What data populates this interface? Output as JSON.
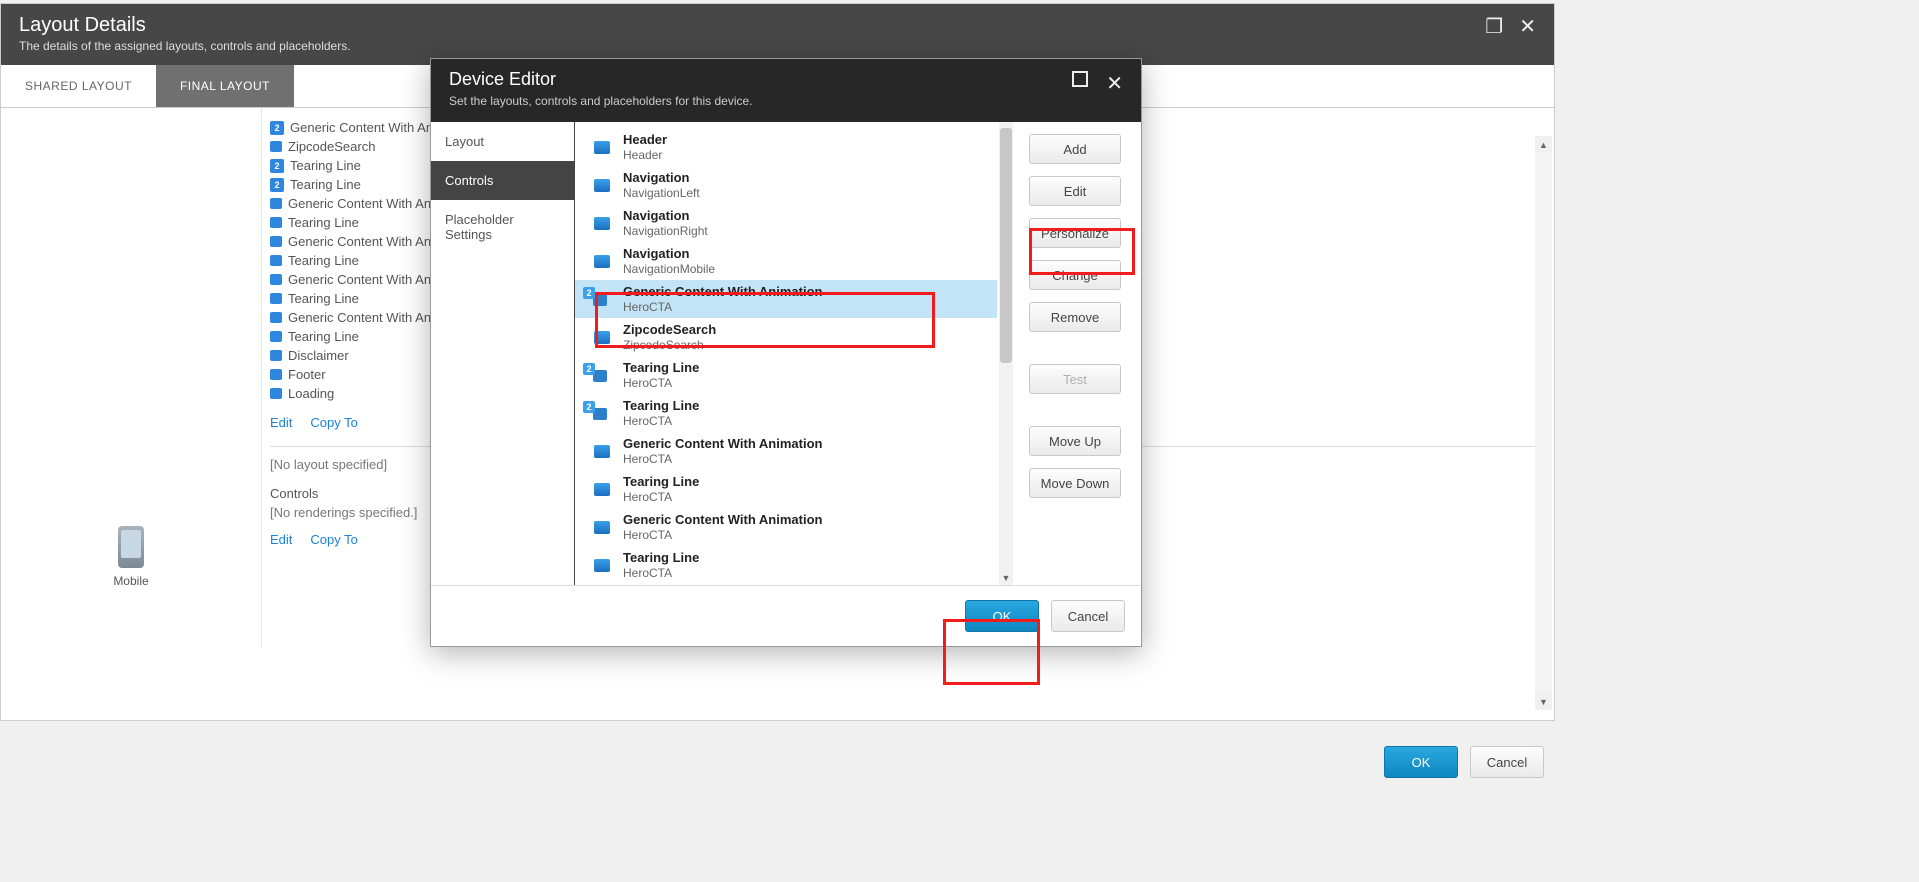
{
  "layoutDetails": {
    "title": "Layout Details",
    "subtitle": "The details of the assigned layouts, controls and placeholders.",
    "tabs": {
      "shared": "SHARED LAYOUT",
      "final": "FINAL LAYOUT"
    },
    "device": {
      "label": "Mobile"
    },
    "list": [
      {
        "badge": "2",
        "label": "Generic Content With An..."
      },
      {
        "badge": null,
        "label": "ZipcodeSearch"
      },
      {
        "badge": "2",
        "label": "Tearing Line"
      },
      {
        "badge": "2",
        "label": "Tearing Line"
      },
      {
        "badge": null,
        "label": "Generic Content With An..."
      },
      {
        "badge": null,
        "label": "Tearing Line"
      },
      {
        "badge": null,
        "label": "Generic Content With An..."
      },
      {
        "badge": null,
        "label": "Tearing Line"
      },
      {
        "badge": null,
        "label": "Generic Content With An..."
      },
      {
        "badge": null,
        "label": "Tearing Line"
      },
      {
        "badge": null,
        "label": "Generic Content With An..."
      },
      {
        "badge": null,
        "label": "Tearing Line"
      },
      {
        "badge": null,
        "label": "Disclaimer"
      },
      {
        "badge": null,
        "label": "Footer"
      },
      {
        "badge": null,
        "label": "Loading"
      }
    ],
    "actions": {
      "edit": "Edit",
      "copyTo": "Copy To"
    },
    "noLayout": "[No layout specified]",
    "controlsHeading": "Controls",
    "noRenderings": "[No renderings specified.]",
    "footer": {
      "ok": "OK",
      "cancel": "Cancel"
    }
  },
  "deviceEditor": {
    "title": "Device Editor",
    "subtitle": "Set the layouts, controls and placeholders for this device.",
    "nav": {
      "layout": "Layout",
      "controls": "Controls",
      "placeholder": "Placeholder Settings"
    },
    "controls": [
      {
        "badge": null,
        "title": "Header",
        "sub": "Header"
      },
      {
        "badge": null,
        "title": "Navigation",
        "sub": "NavigationLeft"
      },
      {
        "badge": null,
        "title": "Navigation",
        "sub": "NavigationRight"
      },
      {
        "badge": null,
        "title": "Navigation",
        "sub": "NavigationMobile"
      },
      {
        "badge": "2",
        "title": "Generic Content With Animation",
        "sub": "HeroCTA",
        "selected": true
      },
      {
        "badge": null,
        "title": "ZipcodeSearch",
        "sub": "ZipcodeSearch"
      },
      {
        "badge": "2",
        "title": "Tearing Line",
        "sub": "HeroCTA"
      },
      {
        "badge": "2",
        "title": "Tearing Line",
        "sub": "HeroCTA"
      },
      {
        "badge": null,
        "title": "Generic Content With Animation",
        "sub": "HeroCTA"
      },
      {
        "badge": null,
        "title": "Tearing Line",
        "sub": "HeroCTA"
      },
      {
        "badge": null,
        "title": "Generic Content With Animation",
        "sub": "HeroCTA"
      },
      {
        "badge": null,
        "title": "Tearing Line",
        "sub": "HeroCTA"
      }
    ],
    "buttons": {
      "add": "Add",
      "edit": "Edit",
      "personalize": "Personalize",
      "change": "Change",
      "remove": "Remove",
      "test": "Test",
      "moveUp": "Move Up",
      "moveDown": "Move Down"
    },
    "footer": {
      "ok": "OK",
      "cancel": "Cancel"
    }
  }
}
